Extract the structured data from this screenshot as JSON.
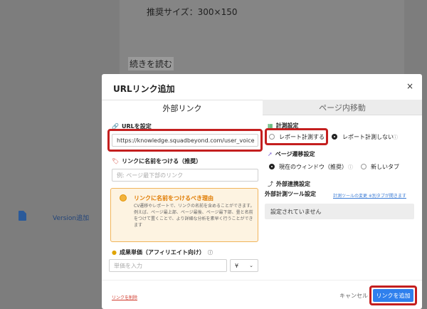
{
  "background": {
    "recommended_size": "推奨サイズ：300×150",
    "read_more": "続きを読む",
    "sidebar_item": "Version追加"
  },
  "modal": {
    "title": "URLリンク追加",
    "close_glyph": "×",
    "tabs": [
      "外部リンク",
      "ページ内移動"
    ],
    "url": {
      "label": "URLを設定",
      "value": "https://knowledge.squadbeyond.com/user_voice"
    },
    "link_name": {
      "label": "リンクに名前をつける（推奨）",
      "placeholder": "例: ページ最下部のリンク"
    },
    "info": {
      "title": "リンクに名前をつけるべき理由",
      "body": "CV遷移やレポートで、リンクの名前を含めることができます。例えば、ページ最上部、ページ最後、ページ最下部、畳と名前をつけて置くことで、より詳細な分析を素早く行うことができます"
    },
    "price": {
      "label": "成果単価（アフィリエイト向け）",
      "placeholder": "単価を入力",
      "currency": "¥"
    },
    "measurement": {
      "label": "計測設定",
      "options": [
        "レポート計測する",
        "レポート計測しない"
      ]
    },
    "transition": {
      "label": "ページ遷移設定",
      "options": [
        "現在のウィンドウ（推奨）",
        "新しいタブ"
      ]
    },
    "external": {
      "label": "外部連携設定",
      "sub_label": "外部計測ツール設定",
      "link_text": "計測ツールの変更 ※別タブが開きます",
      "status": "設定されていません"
    },
    "footer": {
      "delete_link": "リンクを削除",
      "cancel": "キャンセル",
      "add": "リンクを追加"
    }
  },
  "colors": {
    "highlight": "#c41f1f",
    "primary": "#2f80ed",
    "warning": "#e07b00"
  }
}
